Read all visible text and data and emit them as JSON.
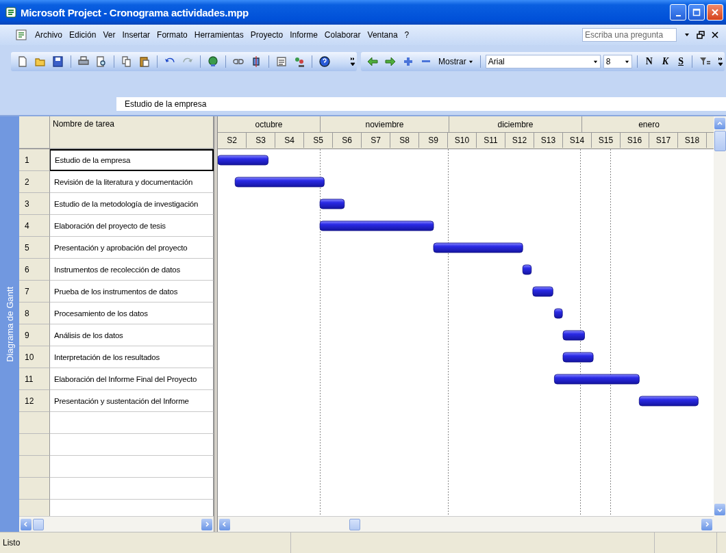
{
  "window": {
    "title": "Microsoft Project - Cronograma actividades.mpp"
  },
  "menu": [
    "Archivo",
    "Edición",
    "Ver",
    "Insertar",
    "Formato",
    "Herramientas",
    "Proyecto",
    "Informe",
    "Colaborar",
    "Ventana",
    "?"
  ],
  "help_box": {
    "placeholder": "Escriba una pregunta"
  },
  "toolbar": {
    "show_button": "Mostrar",
    "font": "Arial",
    "font_size": "8",
    "bold": "N",
    "italic": "K",
    "underline": "S"
  },
  "entry_bar": {
    "value": "Estudio de la empresa"
  },
  "view_bar": {
    "label": "Diagrama de Gantt"
  },
  "table": {
    "name_column": "Nombre de tarea",
    "rows": [
      {
        "id": "1",
        "name": "Estudio de la empresa",
        "selected": true
      },
      {
        "id": "2",
        "name": "Revisión de la literatura y documentación",
        "selected": false
      },
      {
        "id": "3",
        "name": "Estudio de la metodología de investigación",
        "selected": false
      },
      {
        "id": "4",
        "name": "Elaboración del proyecto de tesis",
        "selected": false
      },
      {
        "id": "5",
        "name": "Presentación y aprobación del proyecto",
        "selected": false
      },
      {
        "id": "6",
        "name": "Instrumentos de recolección de datos",
        "selected": false
      },
      {
        "id": "7",
        "name": "Prueba de los instrumentos de datos",
        "selected": false
      },
      {
        "id": "8",
        "name": "Procesamiento de los datos",
        "selected": false
      },
      {
        "id": "9",
        "name": "Análisis de los datos",
        "selected": false
      },
      {
        "id": "10",
        "name": "Interpretación de los resultados",
        "selected": false
      },
      {
        "id": "11",
        "name": "Elaboración del Informe Final del Proyecto",
        "selected": false
      },
      {
        "id": "12",
        "name": "Presentación y sustentación del Informe",
        "selected": false
      }
    ]
  },
  "gantt": {
    "months": [
      "octubre",
      "noviembre",
      "diciembre",
      "enero"
    ],
    "weeks": [
      "S2",
      "S3",
      "S4",
      "S5",
      "S6",
      "S7",
      "S8",
      "S9",
      "S10",
      "S11",
      "S12",
      "S13",
      "S14",
      "S15",
      "S16",
      "S17",
      "S18"
    ]
  },
  "status_bar": {
    "text": "Listo"
  }
}
